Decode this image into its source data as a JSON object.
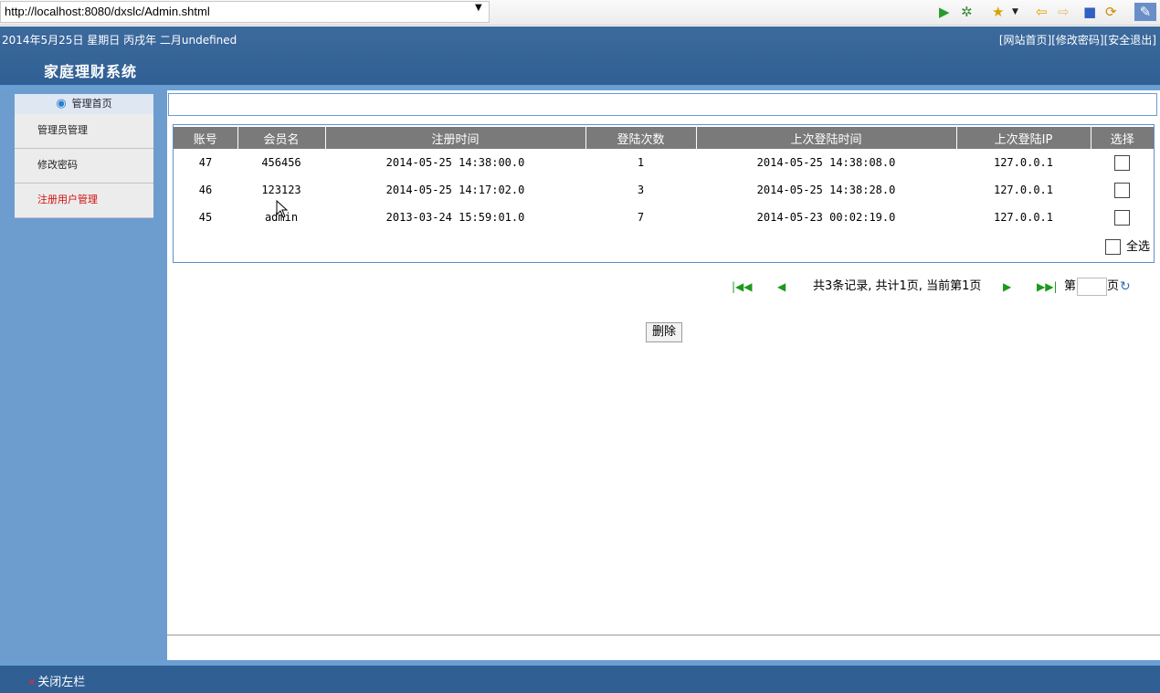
{
  "browser": {
    "url": "http://localhost:8080/dxslc/Admin.shtml"
  },
  "header": {
    "date_line": "2014年5月25日 星期日 丙戌年 二月undefined",
    "links": [
      "[网站首页]",
      "[修改密码]",
      "[安全退出]"
    ],
    "system_title": "家庭理财系统"
  },
  "sidebar": {
    "top_label": "管理首页",
    "items": [
      {
        "label": "管理员管理",
        "active": false
      },
      {
        "label": "修改密码",
        "active": false
      },
      {
        "label": "注册用户管理",
        "active": true
      }
    ]
  },
  "table": {
    "columns": [
      "账号",
      "会员名",
      "注册时间",
      "登陆次数",
      "上次登陆时间",
      "上次登陆IP",
      "选择"
    ],
    "rows": [
      {
        "id": "47",
        "name": "456456",
        "reg_time": "2014-05-25 14:38:00.0",
        "login_count": "1",
        "last_login": "2014-05-25 14:38:08.0",
        "ip": "127.0.0.1"
      },
      {
        "id": "46",
        "name": "123123",
        "reg_time": "2014-05-25 14:17:02.0",
        "login_count": "3",
        "last_login": "2014-05-25 14:38:28.0",
        "ip": "127.0.0.1"
      },
      {
        "id": "45",
        "name": "admin",
        "reg_time": "2013-03-24 15:59:01.0",
        "login_count": "7",
        "last_login": "2014-05-23 00:02:19.0",
        "ip": "127.0.0.1"
      }
    ],
    "select_all_label": "全选"
  },
  "pager": {
    "info": "共3条记录, 共计1页, 当前第1页",
    "page_prefix": "第",
    "page_suffix": "页"
  },
  "actions": {
    "delete_label": "删除"
  },
  "footer": {
    "close_sidebar_label": "关闭左栏"
  },
  "colors": {
    "header_blue": "#3d6a9d",
    "sidebar_blue": "#6d9ccf",
    "table_header_gray": "#7a7a7a",
    "active_red": "#d01010"
  }
}
